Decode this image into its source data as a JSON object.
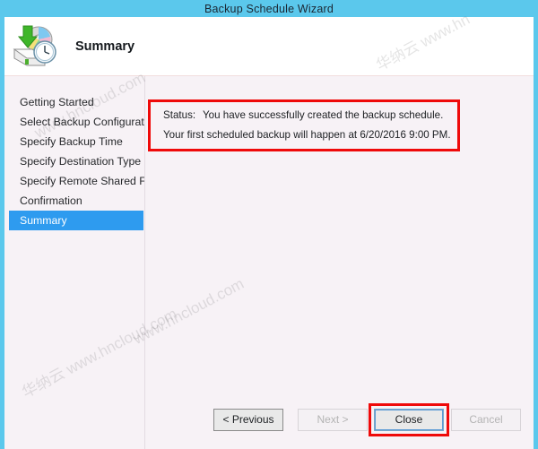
{
  "window": {
    "title": "Backup Schedule Wizard",
    "titlebar_color": "#5bc8ec",
    "background_color": "#f7f2f6"
  },
  "header": {
    "title": "Summary",
    "icon": "backup-schedule-disk-clock-icon"
  },
  "sidebar": {
    "items": [
      {
        "label": "Getting Started",
        "selected": false
      },
      {
        "label": "Select Backup Configurat...",
        "selected": false
      },
      {
        "label": "Specify Backup Time",
        "selected": false
      },
      {
        "label": "Specify Destination Type",
        "selected": false
      },
      {
        "label": "Specify Remote Shared F...",
        "selected": false
      },
      {
        "label": "Confirmation",
        "selected": false
      },
      {
        "label": "Summary",
        "selected": true
      }
    ],
    "selected_color": "#2e9bef"
  },
  "content": {
    "status_label": "Status:",
    "status_message": "You have successfully created the backup schedule.",
    "schedule_message": "Your first scheduled backup will happen at 6/20/2016 9:00 PM.",
    "annotation_color": "#ef0a0a"
  },
  "footer": {
    "buttons": [
      {
        "label": "< Previous",
        "enabled": true
      },
      {
        "label": "Next >",
        "enabled": false
      },
      {
        "label": "Close",
        "enabled": true,
        "focused": true,
        "annotated": true
      },
      {
        "label": "Cancel",
        "enabled": false
      }
    ]
  },
  "watermarks": {
    "w1": "华纳云 www.hn",
    "w2": "www.hncloud.com",
    "w3": "www.hncloud.com",
    "w4": "华纳云 www.hncloud.com"
  }
}
